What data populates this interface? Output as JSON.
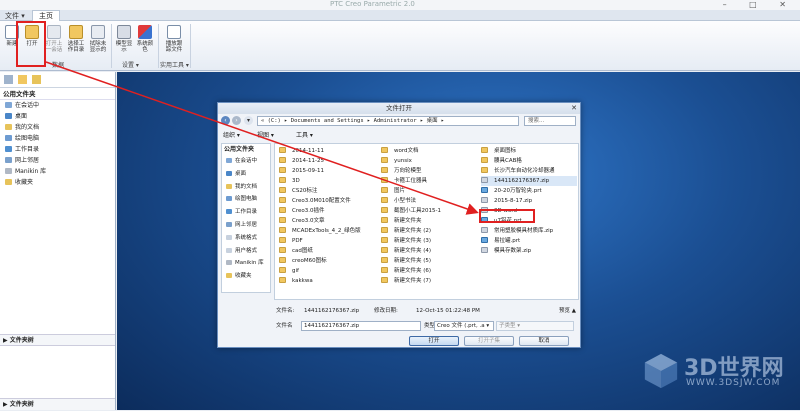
{
  "app": {
    "title": "PTC Creo Parametric 2.0",
    "menu_file": "文件 ▾",
    "tab_home": "主页"
  },
  "ribbon": {
    "buttons": [
      {
        "label": "新建",
        "icon": "new-icon"
      },
      {
        "label": "打开",
        "icon": "open-folder-icon"
      },
      {
        "label": "打开上一会话",
        "icon": "open-last-session-icon"
      },
      {
        "label": "选择工作目录",
        "icon": "working-directory-icon"
      },
      {
        "label": "拭除未显示的",
        "icon": "erase-not-displayed-icon"
      },
      {
        "label": "模型显示",
        "icon": "model-display-icon"
      },
      {
        "label": "系统颜色",
        "icon": "system-colors-icon"
      },
      {
        "label": "播放跟踪文件",
        "icon": "play-trail-file-icon"
      }
    ],
    "groups": [
      "数据",
      "设置 ▾",
      "实用工具 ▾"
    ]
  },
  "left_panel": {
    "header": "公用文件夹",
    "items": [
      {
        "label": "在会话中",
        "color": "#7fa7d6"
      },
      {
        "label": "桌面",
        "color": "#4a86c8"
      },
      {
        "label": "我的文档",
        "color": "#e7c35a"
      },
      {
        "label": "绘图电脑",
        "color": "#6d9bd1"
      },
      {
        "label": "工作目录",
        "color": "#4f8fd0"
      },
      {
        "label": "网上邻居",
        "color": "#7aa0cc"
      },
      {
        "label": "Manikin 库",
        "color": "#b0b8c4"
      },
      {
        "label": "收藏夹",
        "color": "#e7c35a"
      }
    ],
    "folder_tree": "▶ 文件夹树",
    "bottom": "▶ 文件夹树"
  },
  "dialog": {
    "title": "文件打开",
    "address": "« (C:) ▸ Documents and Settings ▸ Administrator ▸ 桌面 ▸",
    "search_placeholder": "搜索...",
    "toolbar": {
      "organize": "组织 ▾",
      "views": "视图 ▾",
      "tools": "工具 ▾"
    },
    "left_header": "公用文件夹",
    "left_items": [
      "在会话中",
      "桌面",
      "我的文档",
      "绘图电脑",
      "工作目录",
      "网上邻居",
      "系统格式",
      "用户格式",
      "Manikin 库",
      "收藏夹"
    ],
    "files": {
      "col1": [
        {
          "name": "2014-11-11",
          "type": "folder"
        },
        {
          "name": "2014-11-25",
          "type": "folder"
        },
        {
          "name": "2015-09-11",
          "type": "folder"
        },
        {
          "name": "3D",
          "type": "folder"
        },
        {
          "name": "CS20标注",
          "type": "folder"
        },
        {
          "name": "Creo3.0M010配置文件",
          "type": "folder"
        },
        {
          "name": "Creo3.0插件",
          "type": "folder"
        },
        {
          "name": "Creo3.0文章",
          "type": "folder"
        },
        {
          "name": "MCADExTools_4_2_绿色版",
          "type": "folder"
        },
        {
          "name": "PDF",
          "type": "folder"
        },
        {
          "name": "cad图纸",
          "type": "folder"
        },
        {
          "name": "creoM60图标",
          "type": "folder"
        },
        {
          "name": "gif",
          "type": "folder"
        },
        {
          "name": "kakkwa",
          "type": "folder"
        }
      ],
      "col2": [
        {
          "name": "word文档",
          "type": "folder"
        },
        {
          "name": "yunsix",
          "type": "folder"
        },
        {
          "name": "万向轮模型",
          "type": "folder"
        },
        {
          "name": "卡箍工位器具",
          "type": "folder"
        },
        {
          "name": "图片",
          "type": "folder"
        },
        {
          "name": "小型书法",
          "type": "folder"
        },
        {
          "name": "截图小工具2015-1",
          "type": "folder"
        },
        {
          "name": "新建文件夹",
          "type": "folder"
        },
        {
          "name": "新建文件夹 (2)",
          "type": "folder"
        },
        {
          "name": "新建文件夹 (3)",
          "type": "folder"
        },
        {
          "name": "新建文件夹 (4)",
          "type": "folder"
        },
        {
          "name": "新建文件夹 (5)",
          "type": "folder"
        },
        {
          "name": "新建文件夹 (6)",
          "type": "folder"
        },
        {
          "name": "新建文件夹 (7)",
          "type": "folder"
        }
      ],
      "col3": [
        {
          "name": "桌面图标",
          "type": "folder"
        },
        {
          "name": "腰具CAB格",
          "type": "folder"
        },
        {
          "name": "长沙汽车自动化冷却器通",
          "type": "folder"
        },
        {
          "name": "1441162176367.zip",
          "type": "zip",
          "selected": true
        },
        {
          "name": "20-20万智轮央.prt",
          "type": "prt"
        },
        {
          "name": "2015-8-17.zip",
          "type": "zip"
        },
        {
          "name": "3D word",
          "type": "zip"
        },
        {
          "name": "u7铝花.prt",
          "type": "prt"
        },
        {
          "name": "常用塑胶模具材质库.zip",
          "type": "zip"
        },
        {
          "name": "易拉罐.prt",
          "type": "prt"
        },
        {
          "name": "模具存数架.zip",
          "type": "zip"
        }
      ]
    },
    "status": {
      "name_label": "文件名:",
      "name_value": "1441162176367.zip",
      "modified_label": "修改日期:",
      "modified_value": "12-Oct-15 01:22:48 PM",
      "preview": "预览 ▲"
    },
    "fname": {
      "label": "文件名",
      "value": "1441162176367.zip",
      "type_label": "类型",
      "type_value": "Creo 文件 (.prt, .a ▾",
      "sub_value": "子类型 ▾"
    },
    "buttons": {
      "open": "打开",
      "open_sub": "打开子集",
      "cancel": "取消"
    }
  },
  "watermark": {
    "text": "3D世界网",
    "url": "WWW.3DSJW.COM"
  }
}
